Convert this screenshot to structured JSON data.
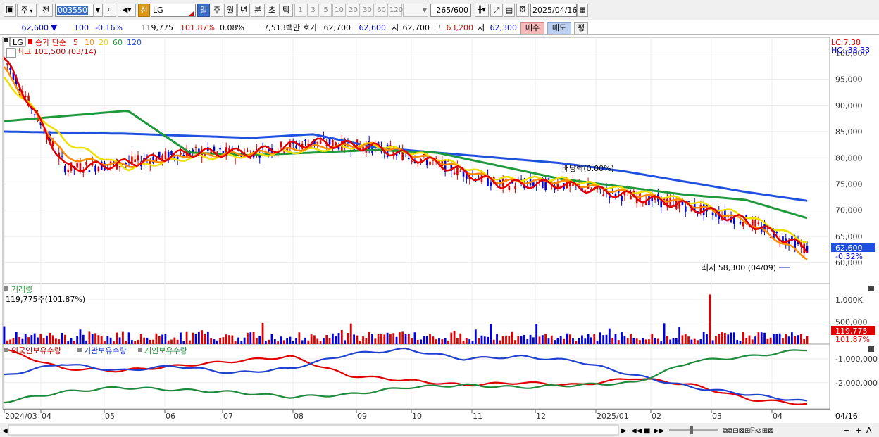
{
  "toolbar": {
    "tab1": "주",
    "tab2": "전",
    "code": "003550",
    "sin_badge": "신",
    "stock_name": "LG",
    "periods": [
      "일",
      "주",
      "월",
      "년",
      "분",
      "초",
      "틱"
    ],
    "numbers": [
      "1",
      "3",
      "5",
      "10",
      "20",
      "30",
      "60",
      "120"
    ],
    "count": "265",
    "total": "/600",
    "date": "2025/04/16"
  },
  "quote": {
    "price": "62,600",
    "arrow": "▼",
    "change": "100",
    "change_pct": "-0.16%",
    "volume": "119,775",
    "vol_ratio": "101.87%",
    "turnover": "0.08%",
    "amount": "7,513백만",
    "hoga_label": "호가",
    "ask": "62,700",
    "bid": "62,600",
    "open_label": "시",
    "open": "62,700",
    "high_label": "고",
    "high": "63,200",
    "low_label": "저",
    "low": "62,300",
    "buy": "매수",
    "sell": "매도",
    "eval": "평"
  },
  "price_panel": {
    "legend_name": "LG",
    "legend_title": "종가 단순",
    "ma_labels": [
      "5",
      "10",
      "20",
      "60",
      "120"
    ],
    "high_note": "최고 101,500 (03/14)",
    "low_note": "최저 58,300 (04/09)",
    "dividend_note": "배당락(0.00%)",
    "lc": "LC:7.38",
    "hc": "HC:-38.33",
    "y_ticks": [
      "100,000",
      "95,000",
      "90,000",
      "85,000",
      "80,000",
      "75,000",
      "70,000",
      "65,000",
      "60,000"
    ],
    "current_tag": "62,600",
    "current_pct": "-0.32%"
  },
  "volume_panel": {
    "title": "거래량",
    "value": "119,775주(101.87%)",
    "y_ticks": [
      "1,000K",
      "500,000"
    ],
    "current_tag": "119,775",
    "current_pct": "101.87%"
  },
  "holding_panel": {
    "legend": [
      "외국인보유수량",
      "기관보유수량",
      "개인보유수량"
    ],
    "y_ticks": [
      "-1,000,000",
      "-2,000,000"
    ]
  },
  "x_axis": [
    "2024/03",
    "04",
    "05",
    "06",
    "07",
    "08",
    "09",
    "10",
    "11",
    "12",
    "2025/01",
    "02",
    "03",
    "04"
  ],
  "x_axis_right": "04/16",
  "colors": {
    "up": "#e00000",
    "down": "#0000e0",
    "ma5": "#e00000",
    "ma10": "#ff8c00",
    "ma20": "#f0e000",
    "ma60": "#1e9a3c",
    "ma120": "#2050e0"
  },
  "chart_data": {
    "type": "line",
    "x": [
      "2024/03",
      "2024/04",
      "2024/05",
      "2024/06",
      "2024/07",
      "2024/08",
      "2024/09",
      "2024/10",
      "2024/11",
      "2024/12",
      "2025/01",
      "2025/02",
      "2025/03",
      "2025/04"
    ],
    "series": [
      {
        "name": "5",
        "values": [
          99000,
          78000,
          79000,
          81000,
          81000,
          83000,
          82000,
          79000,
          75000,
          75000,
          73000,
          71000,
          68000,
          62600
        ]
      },
      {
        "name": "10",
        "values": [
          97000,
          80000,
          78500,
          80500,
          80800,
          82000,
          82500,
          79500,
          75500,
          75500,
          73500,
          71500,
          68000,
          61000
        ]
      },
      {
        "name": "20",
        "values": [
          95000,
          83000,
          78000,
          80000,
          80500,
          81500,
          82500,
          80000,
          76000,
          76000,
          74000,
          72000,
          69000,
          64000
        ]
      },
      {
        "name": "60",
        "values": [
          87000,
          88000,
          89000,
          81000,
          80500,
          81000,
          81500,
          81000,
          78500,
          76000,
          74500,
          73000,
          72000,
          68500
        ]
      },
      {
        "name": "120",
        "values": [
          85000,
          84800,
          84600,
          84200,
          83800,
          84500,
          82000,
          81000,
          80000,
          79000,
          77500,
          75500,
          73500,
          71800
        ]
      }
    ],
    "ylim": [
      56000,
      103000
    ]
  }
}
